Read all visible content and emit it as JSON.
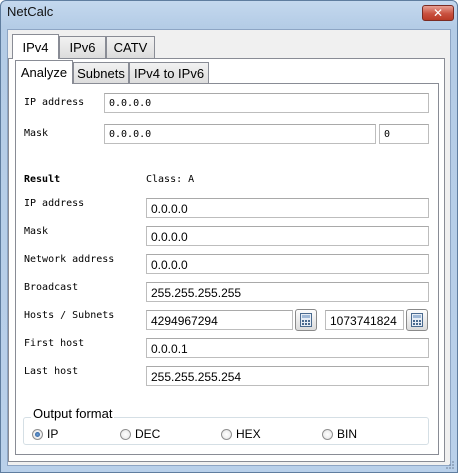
{
  "window": {
    "title": "NetCalc",
    "close_glyph": "✕"
  },
  "tabs": [
    {
      "label": "IPv4",
      "active": true
    },
    {
      "label": "IPv6",
      "active": false
    },
    {
      "label": "CATV",
      "active": false
    }
  ],
  "subtabs": [
    {
      "label": "Analyze",
      "active": true
    },
    {
      "label": "Subnets",
      "active": false
    },
    {
      "label": "IPv4 to IPv6",
      "active": false
    }
  ],
  "input": {
    "ip_label": "IP address",
    "ip_value": "0.0.0.0",
    "mask_label": "Mask",
    "mask_value": "0.0.0.0",
    "prefix_value": "0"
  },
  "result": {
    "heading": "Result",
    "class_text": "Class: A",
    "rows": [
      {
        "label": "IP address",
        "value": "0.0.0.0"
      },
      {
        "label": "Mask",
        "value": "0.0.0.0"
      },
      {
        "label": "Network address",
        "value": "0.0.0.0"
      },
      {
        "label": "Broadcast",
        "value": "255.255.255.255"
      },
      {
        "label": "Hosts / Subnets",
        "value": "4294967294",
        "value2": "1073741824"
      },
      {
        "label": "First host",
        "value": "0.0.0.1"
      },
      {
        "label": "Last host",
        "value": "255.255.255.254"
      }
    ]
  },
  "output_format": {
    "title": "Output format",
    "options": [
      {
        "label": "IP",
        "selected": true
      },
      {
        "label": "DEC",
        "selected": false
      },
      {
        "label": "HEX",
        "selected": false
      },
      {
        "label": "BIN",
        "selected": false
      }
    ]
  },
  "icons": {
    "close": "close-icon",
    "calculator": "calculator-icon"
  }
}
